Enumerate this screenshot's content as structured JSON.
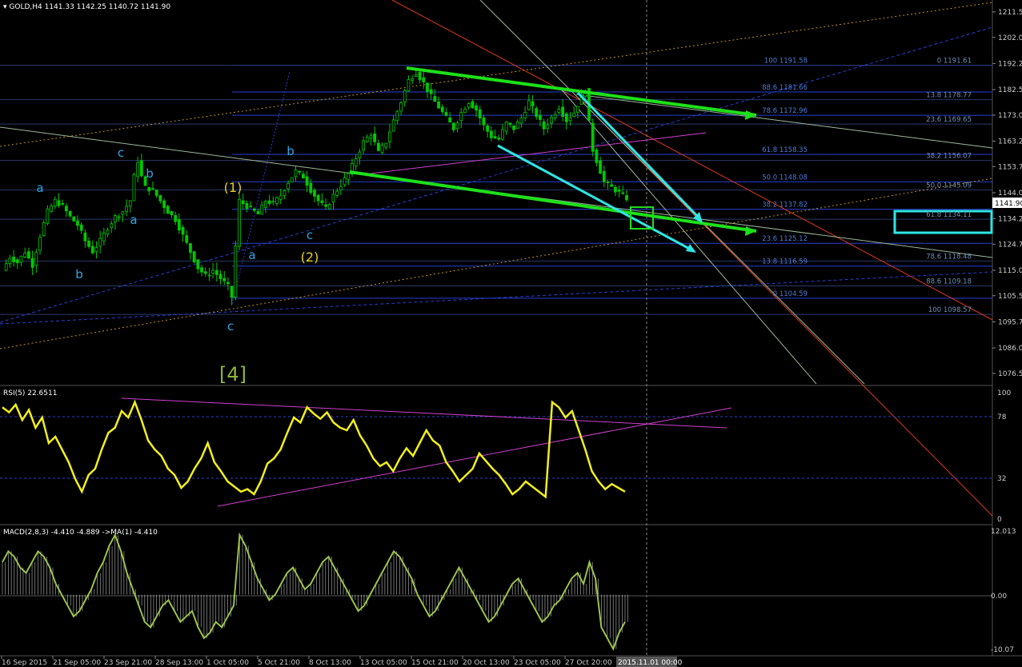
{
  "colors": {
    "background": "#000000",
    "candle": "#00c800",
    "grid": "#1c2e1c",
    "fib_blue": "#2a3fd0",
    "fib_text": "#4f7bd8",
    "wave_blue": "#2fa6e6",
    "wave_yellow": "#e8d31a",
    "wave_green": "#8fb53a",
    "trend_green": "#1ee01a",
    "cyan": "#2ee6e6",
    "magenta": "#d040d0",
    "rsi": "#f2ef1a",
    "macd": "#9bc24c",
    "red": "#e03b17",
    "orange_dotted": "#c8941e",
    "price_label_bg": "#ffffff"
  },
  "header": {
    "symbol_line": "GOLD,H4  1141.33 1142.25 1140.72 1141.90"
  },
  "price_axis": {
    "ticks": [
      "1211.55",
      "1202.03",
      "1192.28",
      "1182.53",
      "1173.00",
      "1163.28",
      "1153.78",
      "1144.03",
      "1134.28",
      "1124.78",
      "1115.03",
      "1105.53",
      "1095.78",
      "1086.03",
      "1076.53"
    ],
    "current_price": "1141.90"
  },
  "time_axis": {
    "ticks": [
      "16 Sep 2015",
      "21 Sep 05:00",
      "23 Sep 21:00",
      "28 Sep 13:00",
      "1 Oct 05:00",
      "5 Oct 21:00",
      "8 Oct 13:00",
      "13 Oct 05:00",
      "15 Oct 21:00",
      "20 Oct 13:00",
      "23 Oct 05:00",
      "27 Oct 20:00"
    ],
    "cursor_label": "2015.11.01 00:00"
  },
  "fib_left": [
    {
      "label": "100 1191.58"
    },
    {
      "label": "88.6 1181.66"
    },
    {
      "label": "78.6 1172.96"
    },
    {
      "label": "61.8 1158.35"
    },
    {
      "label": "50.0 1148.08"
    },
    {
      "label": "38.2 1137.82"
    },
    {
      "label": "23.6 1125.12"
    },
    {
      "label": "13.8 1116.59"
    },
    {
      "label": "0 1104.59"
    }
  ],
  "fib_right": [
    {
      "label": "0 1191.61"
    },
    {
      "label": "13.8 1178.77"
    },
    {
      "label": "23.6 1169.65"
    },
    {
      "label": "38.2 1156.07"
    },
    {
      "label": "50.0 1145.09"
    },
    {
      "label": "61.8 1134.11"
    },
    {
      "label": "78.6 1118.48"
    },
    {
      "label": "88.6 1109.18"
    },
    {
      "label": "100 1098.57"
    }
  ],
  "waves": {
    "blue": [
      "a",
      "b",
      "c",
      "b",
      "a",
      "a",
      "c",
      "b",
      "c"
    ],
    "yellow": [
      "(1)",
      "(2)"
    ],
    "green": "[4]"
  },
  "rsi": {
    "label": "RSI(5) 22.6511",
    "ticks": [
      "100",
      "78",
      "32",
      "0"
    ]
  },
  "macd": {
    "label": "MACD(2,8,3) -4.410 -4.889  ->MA(1) -4.410",
    "ticks": [
      "12.013",
      "0.00",
      "-10.07"
    ]
  },
  "chart_data": [
    {
      "type": "candlestick",
      "title": "GOLD,H4",
      "ylim": [
        1072,
        1216
      ],
      "ohlc_close_path": [
        [
          0,
          1115
        ],
        [
          2,
          1120
        ],
        [
          4,
          1118
        ],
        [
          6,
          1122
        ],
        [
          8,
          1117
        ],
        [
          10,
          1128
        ],
        [
          12,
          1137
        ],
        [
          14,
          1141
        ],
        [
          16,
          1139
        ],
        [
          18,
          1135
        ],
        [
          20,
          1132
        ],
        [
          22,
          1126
        ],
        [
          24,
          1122
        ],
        [
          26,
          1126
        ],
        [
          28,
          1131
        ],
        [
          30,
          1135
        ],
        [
          32,
          1137
        ],
        [
          34,
          1141
        ],
        [
          35,
          1150
        ],
        [
          36,
          1156
        ],
        [
          37,
          1150
        ],
        [
          38,
          1146
        ],
        [
          40,
          1145
        ],
        [
          42,
          1141
        ],
        [
          44,
          1137
        ],
        [
          46,
          1134
        ],
        [
          48,
          1128
        ],
        [
          50,
          1122
        ],
        [
          52,
          1116
        ],
        [
          54,
          1113
        ],
        [
          56,
          1115
        ],
        [
          58,
          1112
        ],
        [
          60,
          1109
        ],
        [
          61,
          1105
        ],
        [
          62,
          1124
        ],
        [
          63,
          1141
        ],
        [
          64,
          1140
        ],
        [
          66,
          1138
        ],
        [
          68,
          1136
        ],
        [
          70,
          1141
        ],
        [
          72,
          1140
        ],
        [
          74,
          1143
        ],
        [
          76,
          1148
        ],
        [
          78,
          1152
        ],
        [
          80,
          1150
        ],
        [
          82,
          1145
        ],
        [
          84,
          1141
        ],
        [
          86,
          1138
        ],
        [
          88,
          1143
        ],
        [
          90,
          1147
        ],
        [
          92,
          1151
        ],
        [
          94,
          1157
        ],
        [
          96,
          1163
        ],
        [
          98,
          1166
        ],
        [
          100,
          1159
        ],
        [
          102,
          1163
        ],
        [
          104,
          1171
        ],
        [
          106,
          1178
        ],
        [
          108,
          1186
        ],
        [
          110,
          1189
        ],
        [
          112,
          1185
        ],
        [
          114,
          1180
        ],
        [
          116,
          1176
        ],
        [
          118,
          1172
        ],
        [
          120,
          1168
        ],
        [
          122,
          1174
        ],
        [
          124,
          1178
        ],
        [
          126,
          1175
        ],
        [
          128,
          1169
        ],
        [
          130,
          1165
        ],
        [
          132,
          1164
        ],
        [
          134,
          1170
        ],
        [
          136,
          1168
        ],
        [
          138,
          1172
        ],
        [
          140,
          1178
        ],
        [
          142,
          1173
        ],
        [
          144,
          1168
        ],
        [
          146,
          1172
        ],
        [
          148,
          1176
        ],
        [
          150,
          1171
        ],
        [
          152,
          1174
        ],
        [
          154,
          1180
        ],
        [
          155,
          1183
        ],
        [
          156,
          1170
        ],
        [
          157,
          1160
        ],
        [
          158,
          1156
        ],
        [
          159,
          1152
        ],
        [
          160,
          1148
        ],
        [
          162,
          1146
        ],
        [
          164,
          1144
        ],
        [
          166,
          1142
        ]
      ]
    },
    {
      "type": "line",
      "title": "RSI(5) 22.6511",
      "ylim": [
        0,
        100
      ],
      "values": [
        88,
        84,
        90,
        78,
        86,
        72,
        80,
        60,
        65,
        55,
        45,
        32,
        22,
        35,
        40,
        55,
        68,
        72,
        85,
        80,
        92,
        78,
        62,
        55,
        50,
        40,
        35,
        25,
        30,
        40,
        48,
        60,
        45,
        38,
        30,
        26,
        22,
        24,
        20,
        30,
        44,
        48,
        55,
        68,
        80,
        76,
        88,
        83,
        79,
        84,
        76,
        72,
        70,
        78,
        66,
        58,
        48,
        42,
        45,
        38,
        48,
        56,
        50,
        60,
        70,
        62,
        58,
        45,
        38,
        30,
        35,
        40,
        52,
        46,
        40,
        35,
        28,
        20,
        24,
        30,
        26,
        22,
        18,
        92,
        88,
        80,
        85,
        70,
        55,
        38,
        30,
        24,
        28,
        25,
        22
      ]
    },
    {
      "type": "line",
      "title": "MACD(2,8,3) -4.410 -4.889  ->MA(1) -4.410",
      "ylim": [
        -10.07,
        12.013
      ],
      "values": [
        6,
        8,
        7,
        5,
        4,
        6,
        8,
        7,
        5,
        2,
        0,
        -2,
        -4,
        -3,
        -1,
        1,
        4,
        6,
        9,
        11,
        8,
        4,
        1,
        -2,
        -5,
        -6,
        -4,
        -2,
        -1,
        -3,
        -5,
        -4,
        -3,
        -6,
        -8,
        -7,
        -5,
        -6,
        -4,
        -2,
        11,
        9,
        6,
        3,
        1,
        -1,
        0,
        2,
        4,
        5,
        3,
        1,
        2,
        4,
        6,
        7,
        5,
        3,
        1,
        -1,
        -3,
        -2,
        0,
        2,
        4,
        6,
        8,
        7,
        5,
        3,
        0,
        -2,
        -4,
        -3,
        -1,
        1,
        3,
        5,
        3,
        1,
        -1,
        -3,
        -5,
        -4,
        -2,
        0,
        2,
        3,
        1,
        -1,
        -3,
        -5,
        -4,
        -2,
        -1,
        1,
        3,
        4,
        2,
        6,
        3,
        -6,
        -8,
        -10,
        -7,
        -5
      ]
    }
  ]
}
